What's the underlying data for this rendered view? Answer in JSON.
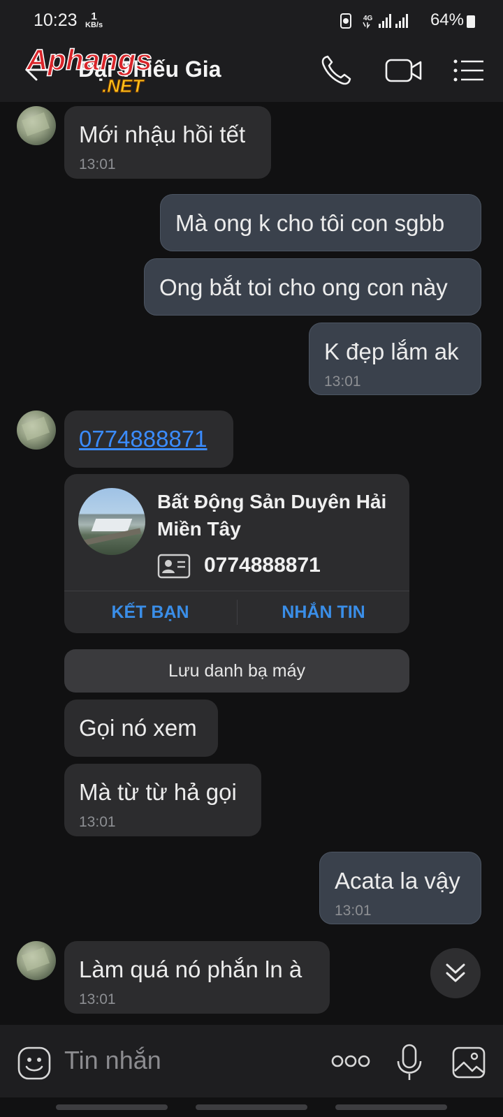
{
  "status_bar": {
    "time": "10:23",
    "speed_value": "1",
    "speed_unit": "KB/s",
    "network": "4G",
    "battery": "64%"
  },
  "header": {
    "title": "Đại Thiếu Gia",
    "watermark_top": "Aphangs",
    "watermark_bottom": ".NET"
  },
  "messages": [
    {
      "direction": "in",
      "text": "Mới nhậu hồi tết",
      "time": "13:01"
    },
    {
      "direction": "out",
      "text": "Mà ong k cho tôi con sgbb"
    },
    {
      "direction": "out",
      "text": "Ong bắt toi cho ong con này"
    },
    {
      "direction": "out",
      "text": "K đẹp lắm ak",
      "time": "13:01"
    },
    {
      "direction": "in",
      "text": "0774888871"
    },
    {
      "direction": "in",
      "text": "Gọi nó xem"
    },
    {
      "direction": "in",
      "text": "Mà từ từ hả gọi",
      "time": "13:01"
    },
    {
      "direction": "out",
      "text": "Acata la vậy",
      "time": "13:01"
    },
    {
      "direction": "in",
      "text": "Làm quá nó phắn ln à",
      "time": "13:01"
    }
  ],
  "contact_card": {
    "name": "Bất Động Sản Duyên Hải Miền Tây",
    "phone": "0774888871",
    "add_friend": "KẾT BẠN",
    "message": "NHẮN TIN"
  },
  "save_contact": "Lưu danh bạ máy",
  "composer": {
    "placeholder": "Tin nhắn"
  },
  "colors": {
    "background": "#111112",
    "bar": "#1d1d1f",
    "incoming_bubble": "#2c2c2e",
    "outgoing_bubble": "#3a414c",
    "link": "#3b8cff",
    "card_action": "#3a8ee8"
  },
  "icons": [
    "back-arrow-icon",
    "phone-icon",
    "video-call-icon",
    "menu-list-icon",
    "contact-id-icon",
    "double-chevron-down-icon",
    "sticker-icon",
    "more-dots-icon",
    "microphone-icon",
    "image-icon"
  ]
}
